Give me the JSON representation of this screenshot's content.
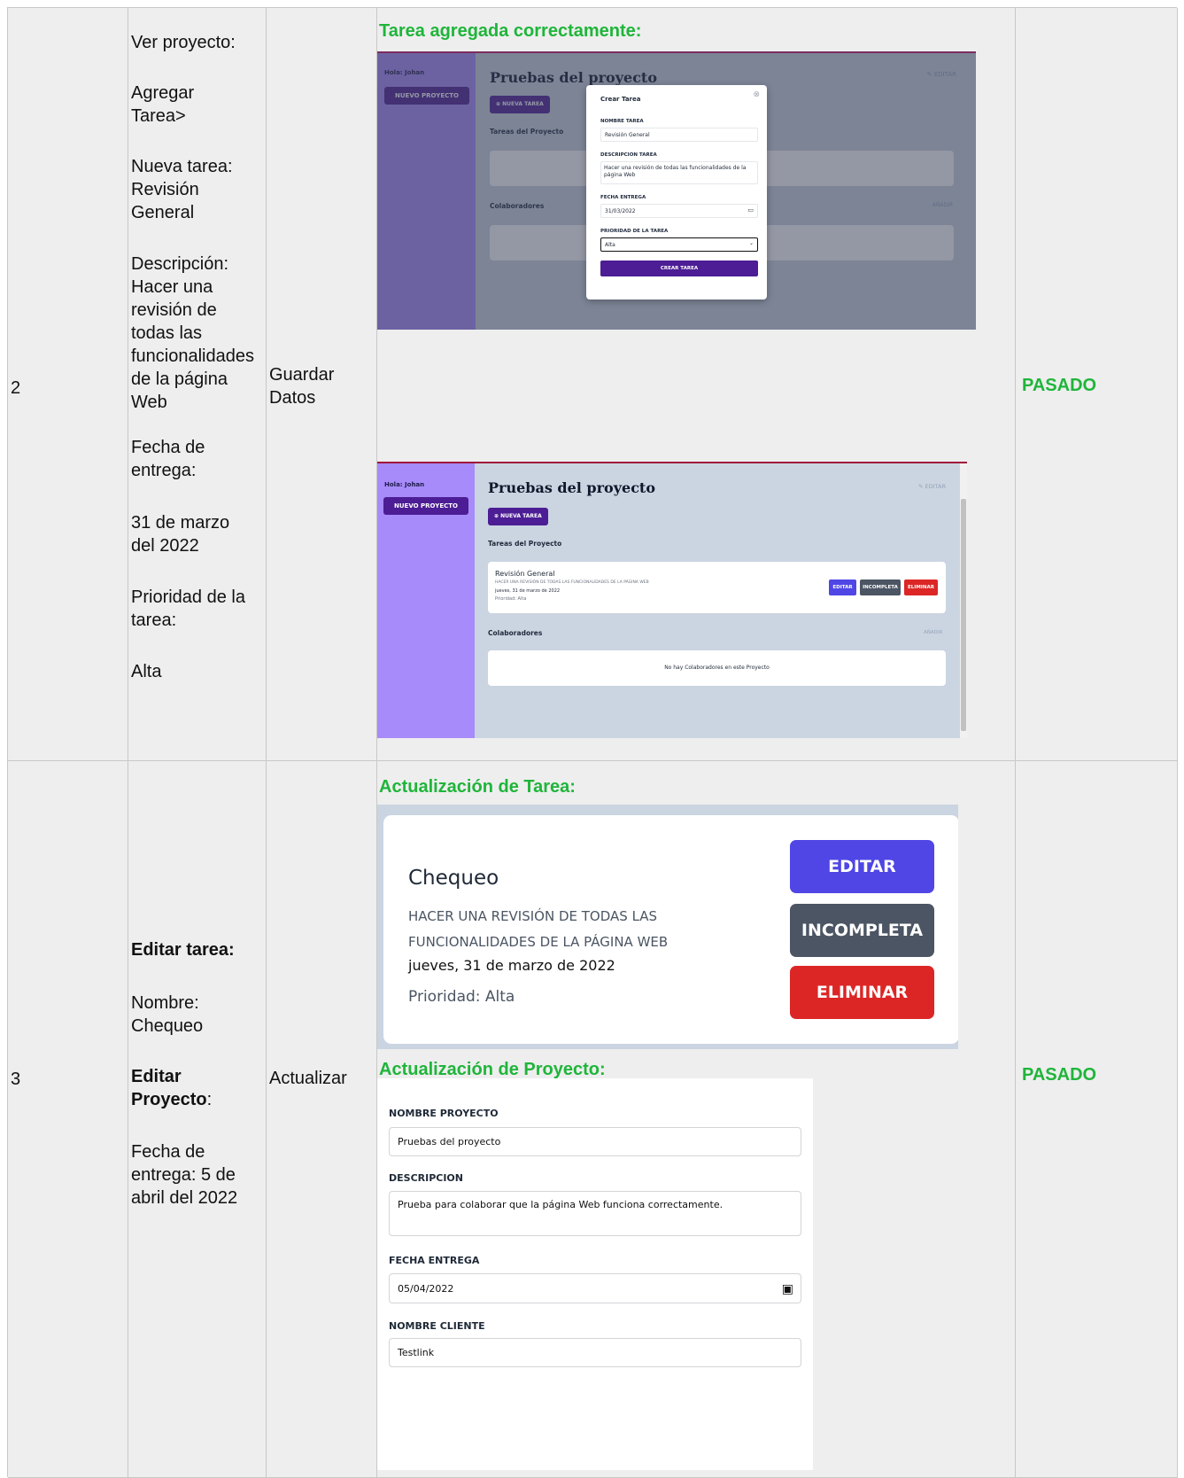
{
  "rows": [
    {
      "num": "2",
      "steps": [
        "Ver proyecto:",
        "Agregar Tarea>",
        "Nueva tarea: Revisión General",
        "Descripción: Hacer una revisión de todas las funcionalidades de la página Web",
        "Fecha de entrega:",
        "31 de marzo del 2022",
        "Prioridad de la tarea:",
        "Alta"
      ],
      "action": "Guardar Datos",
      "evidence_title": "Tarea agregada correctamente:",
      "result": "PASADO"
    },
    {
      "num": "3",
      "steps_bold1": "Editar tarea:",
      "steps_name": "Nombre: Chequeo",
      "steps_bold2": "Editar Proyecto",
      "steps_bold2_suffix": ":",
      "steps_date": "Fecha de entrega: 5 de abril del 2022",
      "action": "Actualizar",
      "evidence_title1": "Actualización de Tarea:",
      "evidence_title2": "Actualización de Proyecto:",
      "result": "PASADO"
    }
  ],
  "app": {
    "greeting": "Hola: Johan",
    "new_project": "NUEVO PROYECTO",
    "project_title": "Pruebas del proyecto",
    "edit": "EDITAR",
    "new_task": "NUEVA TAREA",
    "tasks_heading": "Tareas del Proyecto",
    "collab_heading": "Colaboradores",
    "add": "AÑADIR",
    "no_collab": "No hay Colaboradores en este Proyecto"
  },
  "modal": {
    "title": "Crear Tarea",
    "name_label": "NOMBRE TAREA",
    "name_value": "Revisión General",
    "desc_label": "DESCRIPCION TAREA",
    "desc_value": "Hacer una revisión de todas las funcionalidades de la página Web",
    "date_label": "FECHA ENTREGA",
    "date_value": "31/03/2022",
    "prio_label": "PRIORIDAD DE LA TAREA",
    "prio_value": "Alta",
    "submit": "CREAR TAREA"
  },
  "task": {
    "name": "Revisión General",
    "desc": "HACER UNA REVISIÓN DE TODAS LAS FUNCIONALIDADES DE LA PÁGINA WEB",
    "date": "jueves, 31 de marzo de 2022",
    "priority": "Prioridad: Alta",
    "edit": "EDITAR",
    "incomplete": "INCOMPLETA",
    "delete": "ELIMINAR"
  },
  "task_updated": {
    "name": "Chequeo",
    "desc": "HACER UNA REVISIÓN DE TODAS LAS FUNCIONALIDADES DE LA PÁGINA WEB",
    "date": "jueves, 31 de marzo de 2022",
    "priority": "Prioridad: Alta",
    "edit": "EDITAR",
    "incomplete": "INCOMPLETA",
    "delete": "ELIMINAR"
  },
  "project_form": {
    "name_label": "NOMBRE PROYECTO",
    "name_value": "Pruebas del proyecto",
    "desc_label": "DESCRIPCION",
    "desc_value": "Prueba para colaborar que la página Web funciona correctamente.",
    "date_label": "FECHA ENTREGA",
    "date_value": "05/04/2022",
    "client_label": "NOMBRE CLIENTE",
    "client_value": "Testlink"
  },
  "colors": {
    "pass": "#1fb53a",
    "sidebar": "#a78bfa",
    "main_bg": "#cbd5e1",
    "primary": "#4c1d95",
    "edit_btn": "#4f46e5",
    "incomplete_btn": "#4b5563",
    "delete_btn": "#dc2626"
  }
}
